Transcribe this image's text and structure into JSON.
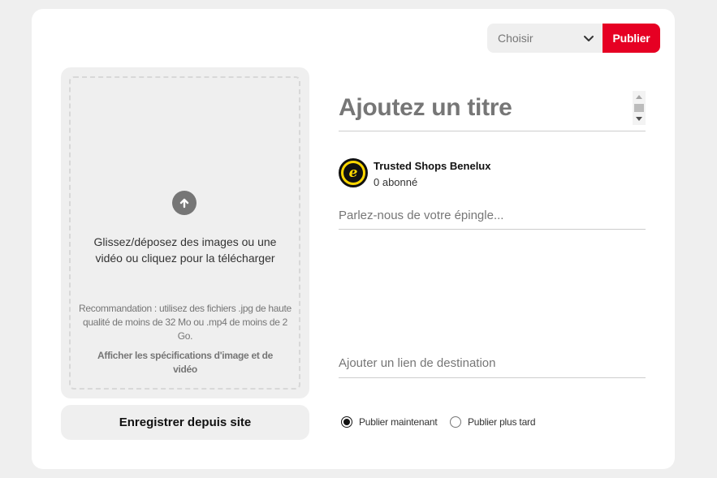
{
  "header": {
    "board_select": {
      "value": "Choisir"
    },
    "publish_label": "Publier"
  },
  "upload": {
    "icon": "upload-arrow-icon",
    "instruction": "Glissez/déposez des images ou une vidéo ou cliquez pour la télécharger",
    "recommendation": "Recommandation : utilisez des fichiers .jpg de haute qualité de moins de 32 Mo ou .mp4 de moins de 2 Go.",
    "specs_link": "Afficher les spécifications d'image et de vidéo"
  },
  "save_from_site_label": "Enregistrer depuis site",
  "form": {
    "title_placeholder": "Ajoutez un titre",
    "account": {
      "name": "Trusted Shops Benelux",
      "followers": "0 abonné",
      "avatar_letter": "e"
    },
    "description_placeholder": "Parlez-nous de votre épingle...",
    "link_placeholder": "Ajouter un lien de destination"
  },
  "publish_timing": {
    "now_label": "Publier maintenant",
    "later_label": "Publier plus tard",
    "selected": "now"
  },
  "colors": {
    "accent": "#e60023",
    "panel": "#efefef",
    "placeholder": "#767676"
  }
}
